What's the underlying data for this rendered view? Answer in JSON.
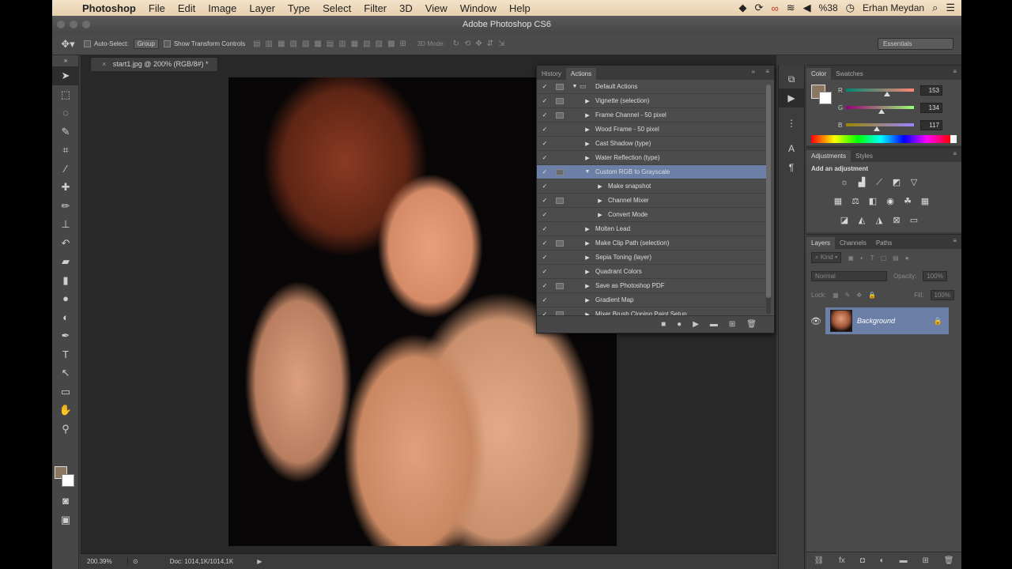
{
  "menubar": {
    "app": "Photoshop",
    "items": [
      "File",
      "Edit",
      "Image",
      "Layer",
      "Type",
      "Select",
      "Filter",
      "3D",
      "View",
      "Window",
      "Help"
    ],
    "battery": "%38",
    "user": "Erhan Meydan"
  },
  "window": {
    "title": "Adobe Photoshop CS6"
  },
  "options": {
    "auto_select_label": "Auto-Select:",
    "auto_select_value": "Group",
    "show_transform_label": "Show Transform Controls",
    "mode_3d_label": "3D Mode:",
    "workspace": "Essentials"
  },
  "document": {
    "tab_title": "start1.jpg @ 200% (RGB/8#) *",
    "zoom": "200.39%",
    "doc_info": "Doc: 1014,1K/1014,1K"
  },
  "actions_panel": {
    "tabs": [
      "History",
      "Actions"
    ],
    "active_tab": "Actions",
    "rows": [
      {
        "label": "Default Actions",
        "level": 0,
        "expanded": true,
        "folder": true,
        "dialog": true,
        "checked": true
      },
      {
        "label": "Vignette (selection)",
        "level": 1,
        "expanded": false,
        "dialog": true,
        "checked": true
      },
      {
        "label": "Frame Channel - 50 pixel",
        "level": 1,
        "expanded": false,
        "dialog": true,
        "checked": true
      },
      {
        "label": "Wood Frame - 50 pixel",
        "level": 1,
        "expanded": false,
        "dialog": false,
        "checked": true
      },
      {
        "label": "Cast Shadow (type)",
        "level": 1,
        "expanded": false,
        "dialog": false,
        "checked": true
      },
      {
        "label": "Water Reflection (type)",
        "level": 1,
        "expanded": false,
        "dialog": false,
        "checked": true
      },
      {
        "label": "Custom RGB to Grayscale",
        "level": 1,
        "expanded": true,
        "dialog": true,
        "checked": true,
        "selected": true
      },
      {
        "label": "Make snapshot",
        "level": 2,
        "expanded": false,
        "dialog": false,
        "checked": true
      },
      {
        "label": "Channel Mixer",
        "level": 2,
        "expanded": false,
        "dialog": true,
        "checked": true
      },
      {
        "label": "Convert Mode",
        "level": 2,
        "expanded": false,
        "dialog": false,
        "checked": true
      },
      {
        "label": "Molten Lead",
        "level": 1,
        "expanded": false,
        "dialog": false,
        "checked": true
      },
      {
        "label": "Make Clip Path (selection)",
        "level": 1,
        "expanded": false,
        "dialog": true,
        "checked": true
      },
      {
        "label": "Sepia Toning (layer)",
        "level": 1,
        "expanded": false,
        "dialog": false,
        "checked": true
      },
      {
        "label": "Quadrant Colors",
        "level": 1,
        "expanded": false,
        "dialog": false,
        "checked": true
      },
      {
        "label": "Save as Photoshop PDF",
        "level": 1,
        "expanded": false,
        "dialog": true,
        "checked": true
      },
      {
        "label": "Gradient Map",
        "level": 1,
        "expanded": false,
        "dialog": false,
        "checked": true
      },
      {
        "label": "Mixer Brush Cloning Paint Setup",
        "level": 1,
        "expanded": false,
        "dialog": true,
        "checked": true
      }
    ]
  },
  "color_panel": {
    "tabs": [
      "Color",
      "Swatches"
    ],
    "r_label": "R",
    "g_label": "G",
    "b_label": "B",
    "r": "153",
    "g": "134",
    "b": "117",
    "r_frac": 0.6,
    "g_frac": 0.525,
    "b_frac": 0.459,
    "foreground": "#99866f"
  },
  "adjustments_panel": {
    "tabs": [
      "Adjustments",
      "Styles"
    ],
    "title": "Add an adjustment"
  },
  "layers_panel": {
    "tabs": [
      "Layers",
      "Channels",
      "Paths"
    ],
    "filter": "Kind",
    "blend_mode": "Normal",
    "opacity_label": "Opacity:",
    "opacity": "100%",
    "lock_label": "Lock:",
    "fill_label": "Fill:",
    "fill": "100%",
    "layer_name": "Background"
  },
  "colors": {
    "selection": "#6c7fa6",
    "panel": "#4a4a4a"
  }
}
